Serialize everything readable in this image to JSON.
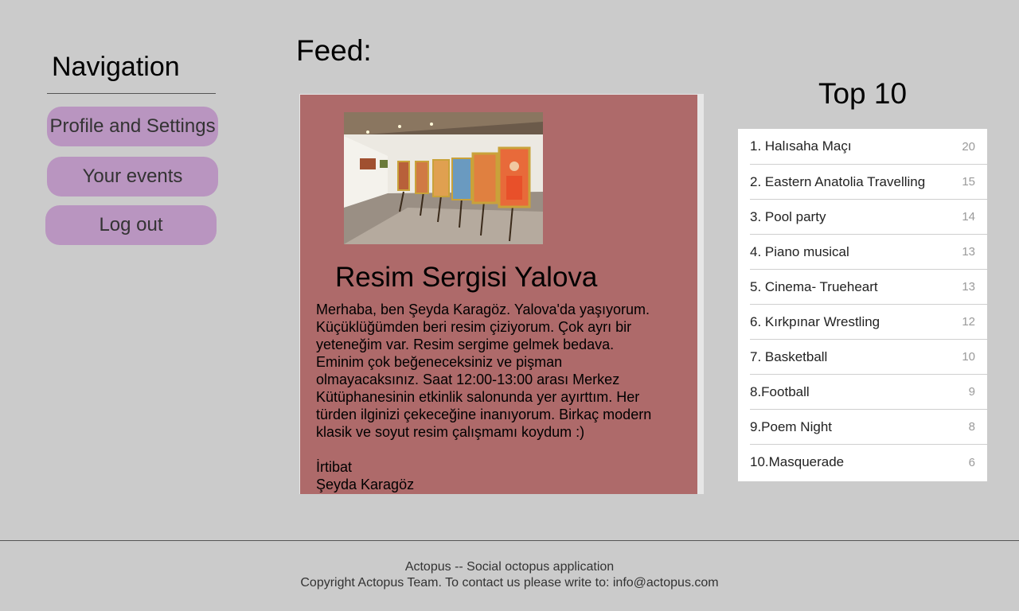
{
  "navigation": {
    "title": "Navigation",
    "buttons": [
      {
        "label": "Profile and Settings"
      },
      {
        "label": "Your events"
      },
      {
        "label": "Log out"
      }
    ]
  },
  "feed": {
    "title": "Feed:",
    "post": {
      "image_alt": "art exhibition photo",
      "title": "Resim Sergisi Yalova",
      "body": "Merhaba, ben Şeyda Karagöz. Yalova'da yaşıyorum. Küçüklüğümden beri resim çiziyorum. Çok ayrı bir yeteneğim var. Resim sergime gelmek bedava. Eminim çok beğeneceksiniz ve pişman olmayacaksınız. Saat 12:00-13:00 arası Merkez Kütüphanesinin etkinlik salonunda yer ayırttım. Her türden ilginizi çekeceğine inanıyorum. Birkaç modern klasik ve soyut resim çalışmamı koydum :)",
      "contact_label": "İrtibat",
      "contact_name": "Şeyda Karagöz"
    }
  },
  "top10": {
    "title": "Top 10",
    "items": [
      {
        "name": "1. Halısaha Maçı",
        "count": "20"
      },
      {
        "name": "2. Eastern Anatolia Travelling",
        "count": "15"
      },
      {
        "name": "3. Pool party",
        "count": "14"
      },
      {
        "name": "4. Piano musical",
        "count": "13"
      },
      {
        "name": "5. Cinema- Trueheart",
        "count": "13"
      },
      {
        "name": "6. Kırkpınar Wrestling",
        "count": "12"
      },
      {
        "name": "7. Basketball",
        "count": "10"
      },
      {
        "name": "8.Football",
        "count": "9"
      },
      {
        "name": "9.Poem Night",
        "count": "8"
      },
      {
        "name": "10.Masquerade",
        "count": "6"
      }
    ]
  },
  "footer": {
    "line1": "Actopus -- Social octopus application",
    "line2": "Copyright Actopus Team. To contact us please write to: info@actopus.com"
  },
  "colors": {
    "background": "#cbcbcb",
    "nav_button": "#b995c0",
    "post_card": "#ae6a6a",
    "list_bg": "#ffffff"
  }
}
